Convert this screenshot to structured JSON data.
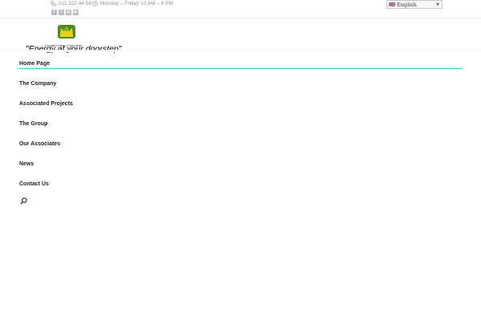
{
  "topbar": {
    "phone": "011 322 44 56",
    "hours": "Monday – Friday 10 AM – 8 PM",
    "icons": [
      "phone-icon",
      "clock-icon"
    ],
    "socials": [
      {
        "name": "facebook-icon",
        "glyph": "f"
      },
      {
        "name": "twitter-icon",
        "glyph": "t"
      },
      {
        "name": "instagram-icon",
        "glyph": "◎"
      },
      {
        "name": "youtube-icon",
        "glyph": "▶"
      }
    ],
    "language": "English"
  },
  "header": {
    "logo_caption": "Coronation Power & Gas Limited",
    "tagline": "\"Energy at your doorstep\""
  },
  "nav": {
    "items": [
      "Home Page",
      "The Company",
      "Associated Projects",
      "The Group",
      "Our Associates",
      "News",
      "Contact Us"
    ],
    "active": "Home Page",
    "search_icon": "search-icon"
  },
  "colors": {
    "accent": "#3fc7b8",
    "logo_green": "#4e8a1f",
    "logo_yellow": "#e6d21c",
    "muted_text": "#8e9398"
  }
}
